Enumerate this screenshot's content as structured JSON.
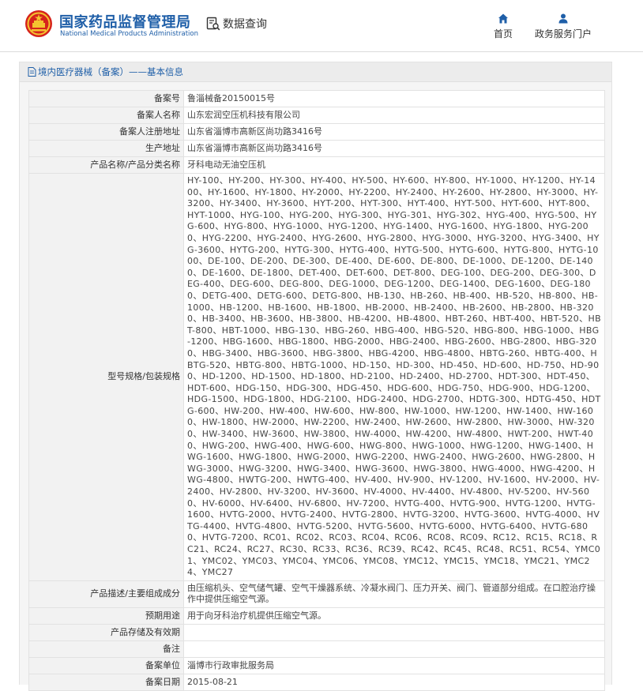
{
  "header": {
    "brand_cn": "国家药品监督管理局",
    "brand_en": "National Medical Products Administration",
    "search_label": "数据查询",
    "nav": {
      "home": "首页",
      "portal": "政务服务门户"
    },
    "colors": {
      "brand": "#1f5fa8",
      "emblem": "#d6231c"
    }
  },
  "panel": {
    "title": "境内医疗器械（备案）——基本信息"
  },
  "record": {
    "filing_no": {
      "label": "备案号",
      "value": "鲁淄械备20150015号"
    },
    "filer_name": {
      "label": "备案人名称",
      "value": "山东宏润空压机科技有限公司"
    },
    "filer_address": {
      "label": "备案人注册地址",
      "value": "山东省淄博市高新区尚功路3416号"
    },
    "production_address": {
      "label": "生产地址",
      "value": "山东省淄博市高新区尚功路3416号"
    },
    "product_name": {
      "label": "产品名称/产品分类名称",
      "value": "牙科电动无油空压机"
    },
    "models": {
      "label": "型号规格/包装规格",
      "value": "HY-100、HY-200、HY-300、HY-400、HY-500、HY-600、HY-800、HY-1000、HY-1200、HY-1400、HY-1600、HY-1800、HY-2000、HY-2200、HY-2400、HY-2600、HY-2800、HY-3000、HY-3200、HY-3400、HY-3600、HYT-200、HYT-300、HYT-400、HYT-500、HYT-600、HYT-800、HYT-1000、HYG-100、HYG-200、HYG-300、HYG-301、HYG-302、HYG-400、HYG-500、HYG-600、HYG-800、HYG-1000、HYG-1200、HYG-1400、HYG-1600、HYG-1800、HYG-2000、HYG-2200、HYG-2400、HYG-2600、HYG-2800、HYG-3000、HYG-3200、HYG-3400、HYG-3600、HYTG-200、HYTG-300、HYTG-400、HYTG-500、HYTG-600、HYTG-800、HYTG-1000、DE-100、DE-200、DE-300、DE-400、DE-600、DE-800、DE-1000、DE-1200、DE-1400、DE-1600、DE-1800、DET-400、DET-600、DET-800、DEG-100、DEG-200、DEG-300、DEG-400、DEG-600、DEG-800、DEG-1000、DEG-1200、DEG-1400、DEG-1600、DEG-1800、DETG-400、DETG-600、DETG-800、HB-130、HB-260、HB-400、HB-520、HB-800、HB-1000、HB-1200、HB-1600、HB-1800、HB-2000、HB-2400、HB-2600、HB-2800、HB-3200、HB-3400、HB-3600、HB-3800、HB-4200、HB-4800、HBT-260、HBT-400、HBT-520、HBT-800、HBT-1000、HBG-130、HBG-260、HBG-400、HBG-520、HBG-800、HBG-1000、HBG-1200、HBG-1600、HBG-1800、HBG-2000、HBG-2400、HBG-2600、HBG-2800、HBG-3200、HBG-3400、HBG-3600、HBG-3800、HBG-4200、HBG-4800、HBTG-260、HBTG-400、HBTG-520、HBTG-800、HBTG-1000、HD-150、HD-300、HD-450、HD-600、HD-750、HD-900、HD-1200、HD-1500、HD-1800、HD-2100、HD-2400、HD-2700、HDT-300、HDT-450、HDT-600、HDG-150、HDG-300、HDG-450、HDG-600、HDG-750、HDG-900、HDG-1200、HDG-1500、HDG-1800、HDG-2100、HDG-2400、HDG-2700、HDTG-300、HDTG-450、HDTG-600、HW-200、HW-400、HW-600、HW-800、HW-1000、HW-1200、HW-1400、HW-1600、HW-1800、HW-2000、HW-2200、HW-2400、HW-2600、HW-2800、HW-3000、HW-3200、HW-3400、HW-3600、HW-3800、HW-4000、HW-4200、HW-4800、HWT-200、HWT-400、HWG-200、HWG-400、HWG-600、HWG-800、HWG-1000、HWG-1200、HWG-1400、HWG-1600、HWG-1800、HWG-2000、HWG-2200、HWG-2400、HWG-2600、HWG-2800、HWG-3000、HWG-3200、HWG-3400、HWG-3600、HWG-3800、HWG-4000、HWG-4200、HWG-4800、HWTG-200、HWTG-400、HV-400、HV-900、HV-1200、HV-1600、HV-2000、HV-2400、HV-2800、HV-3200、HV-3600、HV-4000、HV-4400、HV-4800、HV-5200、HV-5600、HV-6000、HV-6400、HV-6800、HV-7200、HVTG-400、HVTG-900、HVTG-1200、HVTG-1600、HVTG-2000、HVTG-2400、HVTG-2800、HVTG-3200、HVTG-3600、HVTG-4000、HVTG-4400、HVTG-4800、HVTG-5200、HVTG-5600、HVTG-6000、HVTG-6400、HVTG-6800、HVTG-7200、RC01、RC02、RC03、RC04、RC06、RC08、RC09、RC12、RC15、RC18、RC21、RC24、RC27、RC30、RC33、RC36、RC39、RC42、RC45、RC48、RC51、RC54、YMC01、YMC02、YMC03、YMC04、YMC06、YMC08、YMC12、YMC15、YMC18、YMC21、YMC24、YMC27"
    },
    "description": {
      "label": "产品描述/主要组成成分",
      "value": "由压缩机头、空气储气罐、空气干燥器系统、冷凝水阀门、压力开关、阀门、管道部分组成。在口腔治疗操作中提供压缩空气源。"
    },
    "intended_use": {
      "label": "预期用途",
      "value": "用于向牙科治疗机提供压缩空气源。"
    },
    "storage": {
      "label": "产品存储及有效期",
      "value": ""
    },
    "remarks": {
      "label": "备注",
      "value": ""
    },
    "filing_unit": {
      "label": "备案单位",
      "value": "淄博市行政审批服务局"
    },
    "filing_date": {
      "label": "备案日期",
      "value": "2015-08-21"
    }
  }
}
